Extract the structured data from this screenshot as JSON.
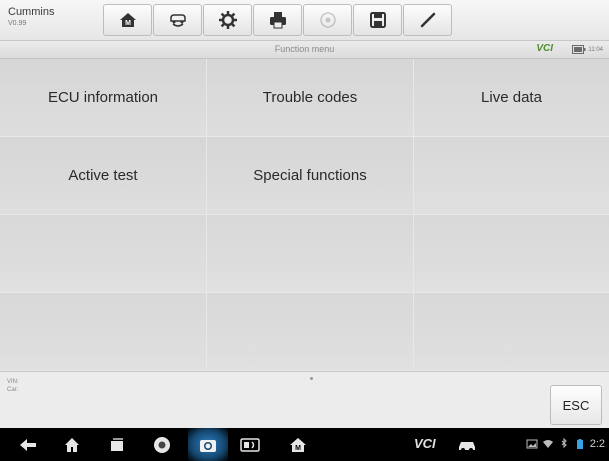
{
  "vehicle": {
    "name": "Cummins",
    "version": "V0.99"
  },
  "toolbar": {
    "buttons": [
      {
        "icon": "home-icon"
      },
      {
        "icon": "vehicle-swap-icon"
      },
      {
        "icon": "settings-gear-icon"
      },
      {
        "icon": "print-icon"
      },
      {
        "icon": "help-icon",
        "disabled": true
      },
      {
        "icon": "save-icon"
      },
      {
        "icon": "pen-icon"
      }
    ]
  },
  "titlebar": {
    "title": "Function menu",
    "vcl": "VCI",
    "time": "11:04"
  },
  "grid": {
    "cells": [
      "ECU information",
      "Trouble codes",
      "Live data",
      "Active test",
      "Special functions",
      "",
      "",
      "",
      "",
      "",
      "",
      ""
    ]
  },
  "info": {
    "vin_label": "VIN:",
    "car_label": "Car:",
    "esc_label": "ESC"
  },
  "navbar": {
    "vcl": "VCI",
    "clock": "2:2",
    "accent": "#2f7fc5"
  }
}
